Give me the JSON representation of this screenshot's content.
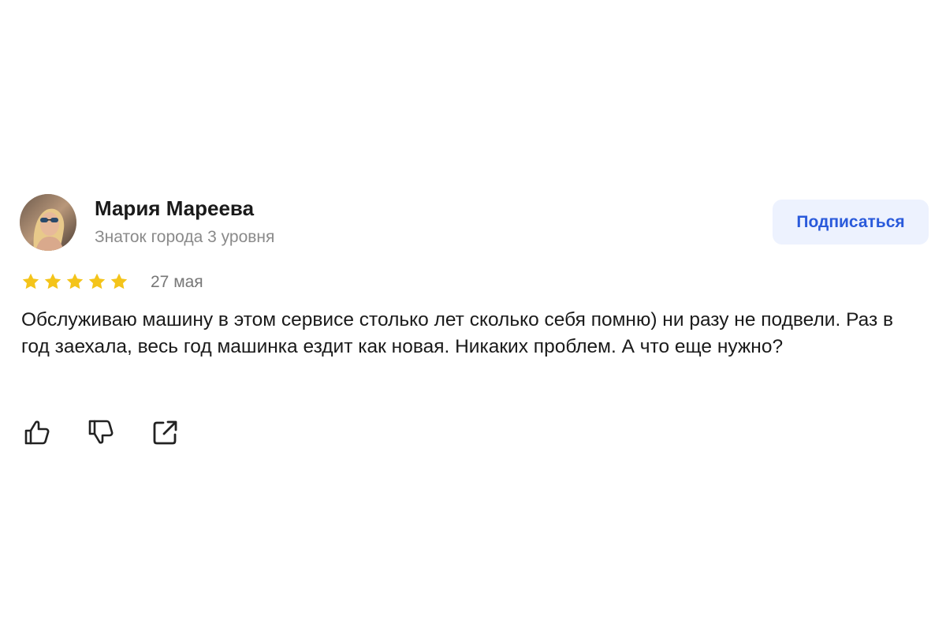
{
  "review": {
    "author": {
      "name": "Мария Мареева",
      "level": "Знаток города 3 уровня",
      "avatar_icon": "user-photo"
    },
    "subscribe_label": "Подписаться",
    "rating": 5,
    "rating_max": 5,
    "date": "27 мая",
    "text": "Обслуживаю машину в этом сервисе столько лет сколько себя помню) ни разу не подвели. Раз в год заехала, весь год машинка ездит как новая. Никаких проблем. А что еще нужно?",
    "actions": [
      {
        "icon": "thumbs-up-icon"
      },
      {
        "icon": "thumbs-down-icon"
      },
      {
        "icon": "share-icon"
      }
    ]
  },
  "colors": {
    "star": "#f4c41a",
    "subscribe_bg": "#edf2fe",
    "subscribe_text": "#2a5adb",
    "muted_text": "#8a8a8a"
  }
}
